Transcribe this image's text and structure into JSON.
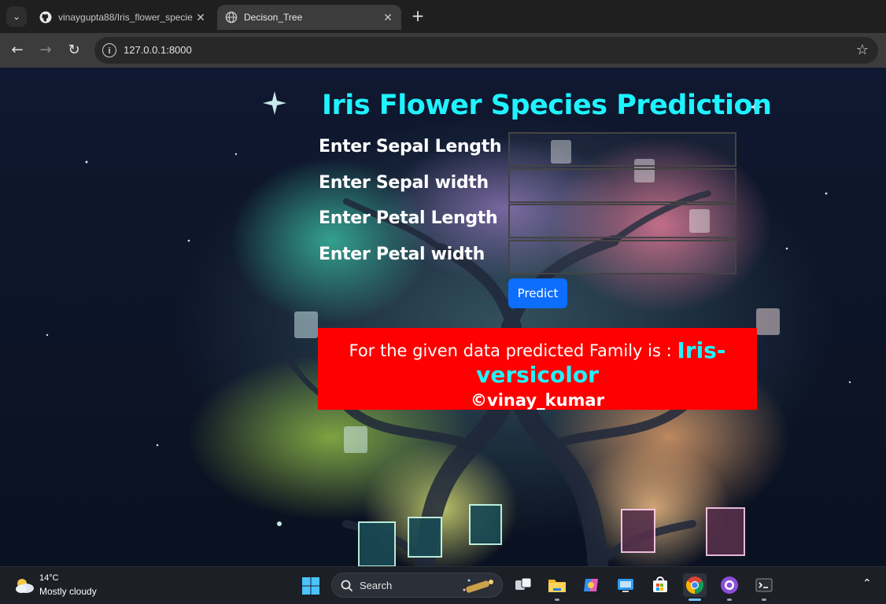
{
  "browser": {
    "tabs": [
      {
        "title": "vinaygupta88/Iris_flower_specie",
        "icon": "github-icon",
        "active": false
      },
      {
        "title": "Decison_Tree",
        "icon": "globe-icon",
        "active": true
      }
    ],
    "url": "127.0.0.1:8000"
  },
  "page": {
    "title": "Iris Flower Species Prediction",
    "fields": [
      {
        "label": "Enter Sepal Length",
        "value": ""
      },
      {
        "label": "Enter Sepal width",
        "value": ""
      },
      {
        "label": "Enter Petal Length",
        "value": ""
      },
      {
        "label": "Enter Petal width",
        "value": ""
      }
    ],
    "predict_label": "Predict",
    "result_text": "For the given data predicted Family is :",
    "result_value_part1": "Iris-",
    "result_value_part2": "versicolor",
    "credit": "©vinay_kumar",
    "colors": {
      "title": "#1ff3ff",
      "result_bg": "#ff0000",
      "button": "#0d6efd"
    }
  },
  "taskbar": {
    "weather_temp": "14°C",
    "weather_desc": "Mostly cloudy",
    "search_label": "Search",
    "apps": [
      "task-view-icon",
      "file-explorer-icon",
      "copilot-icon",
      "remote-desktop-icon",
      "microsoft-store-icon",
      "chrome-icon",
      "github-desktop-icon",
      "terminal-icon"
    ]
  }
}
